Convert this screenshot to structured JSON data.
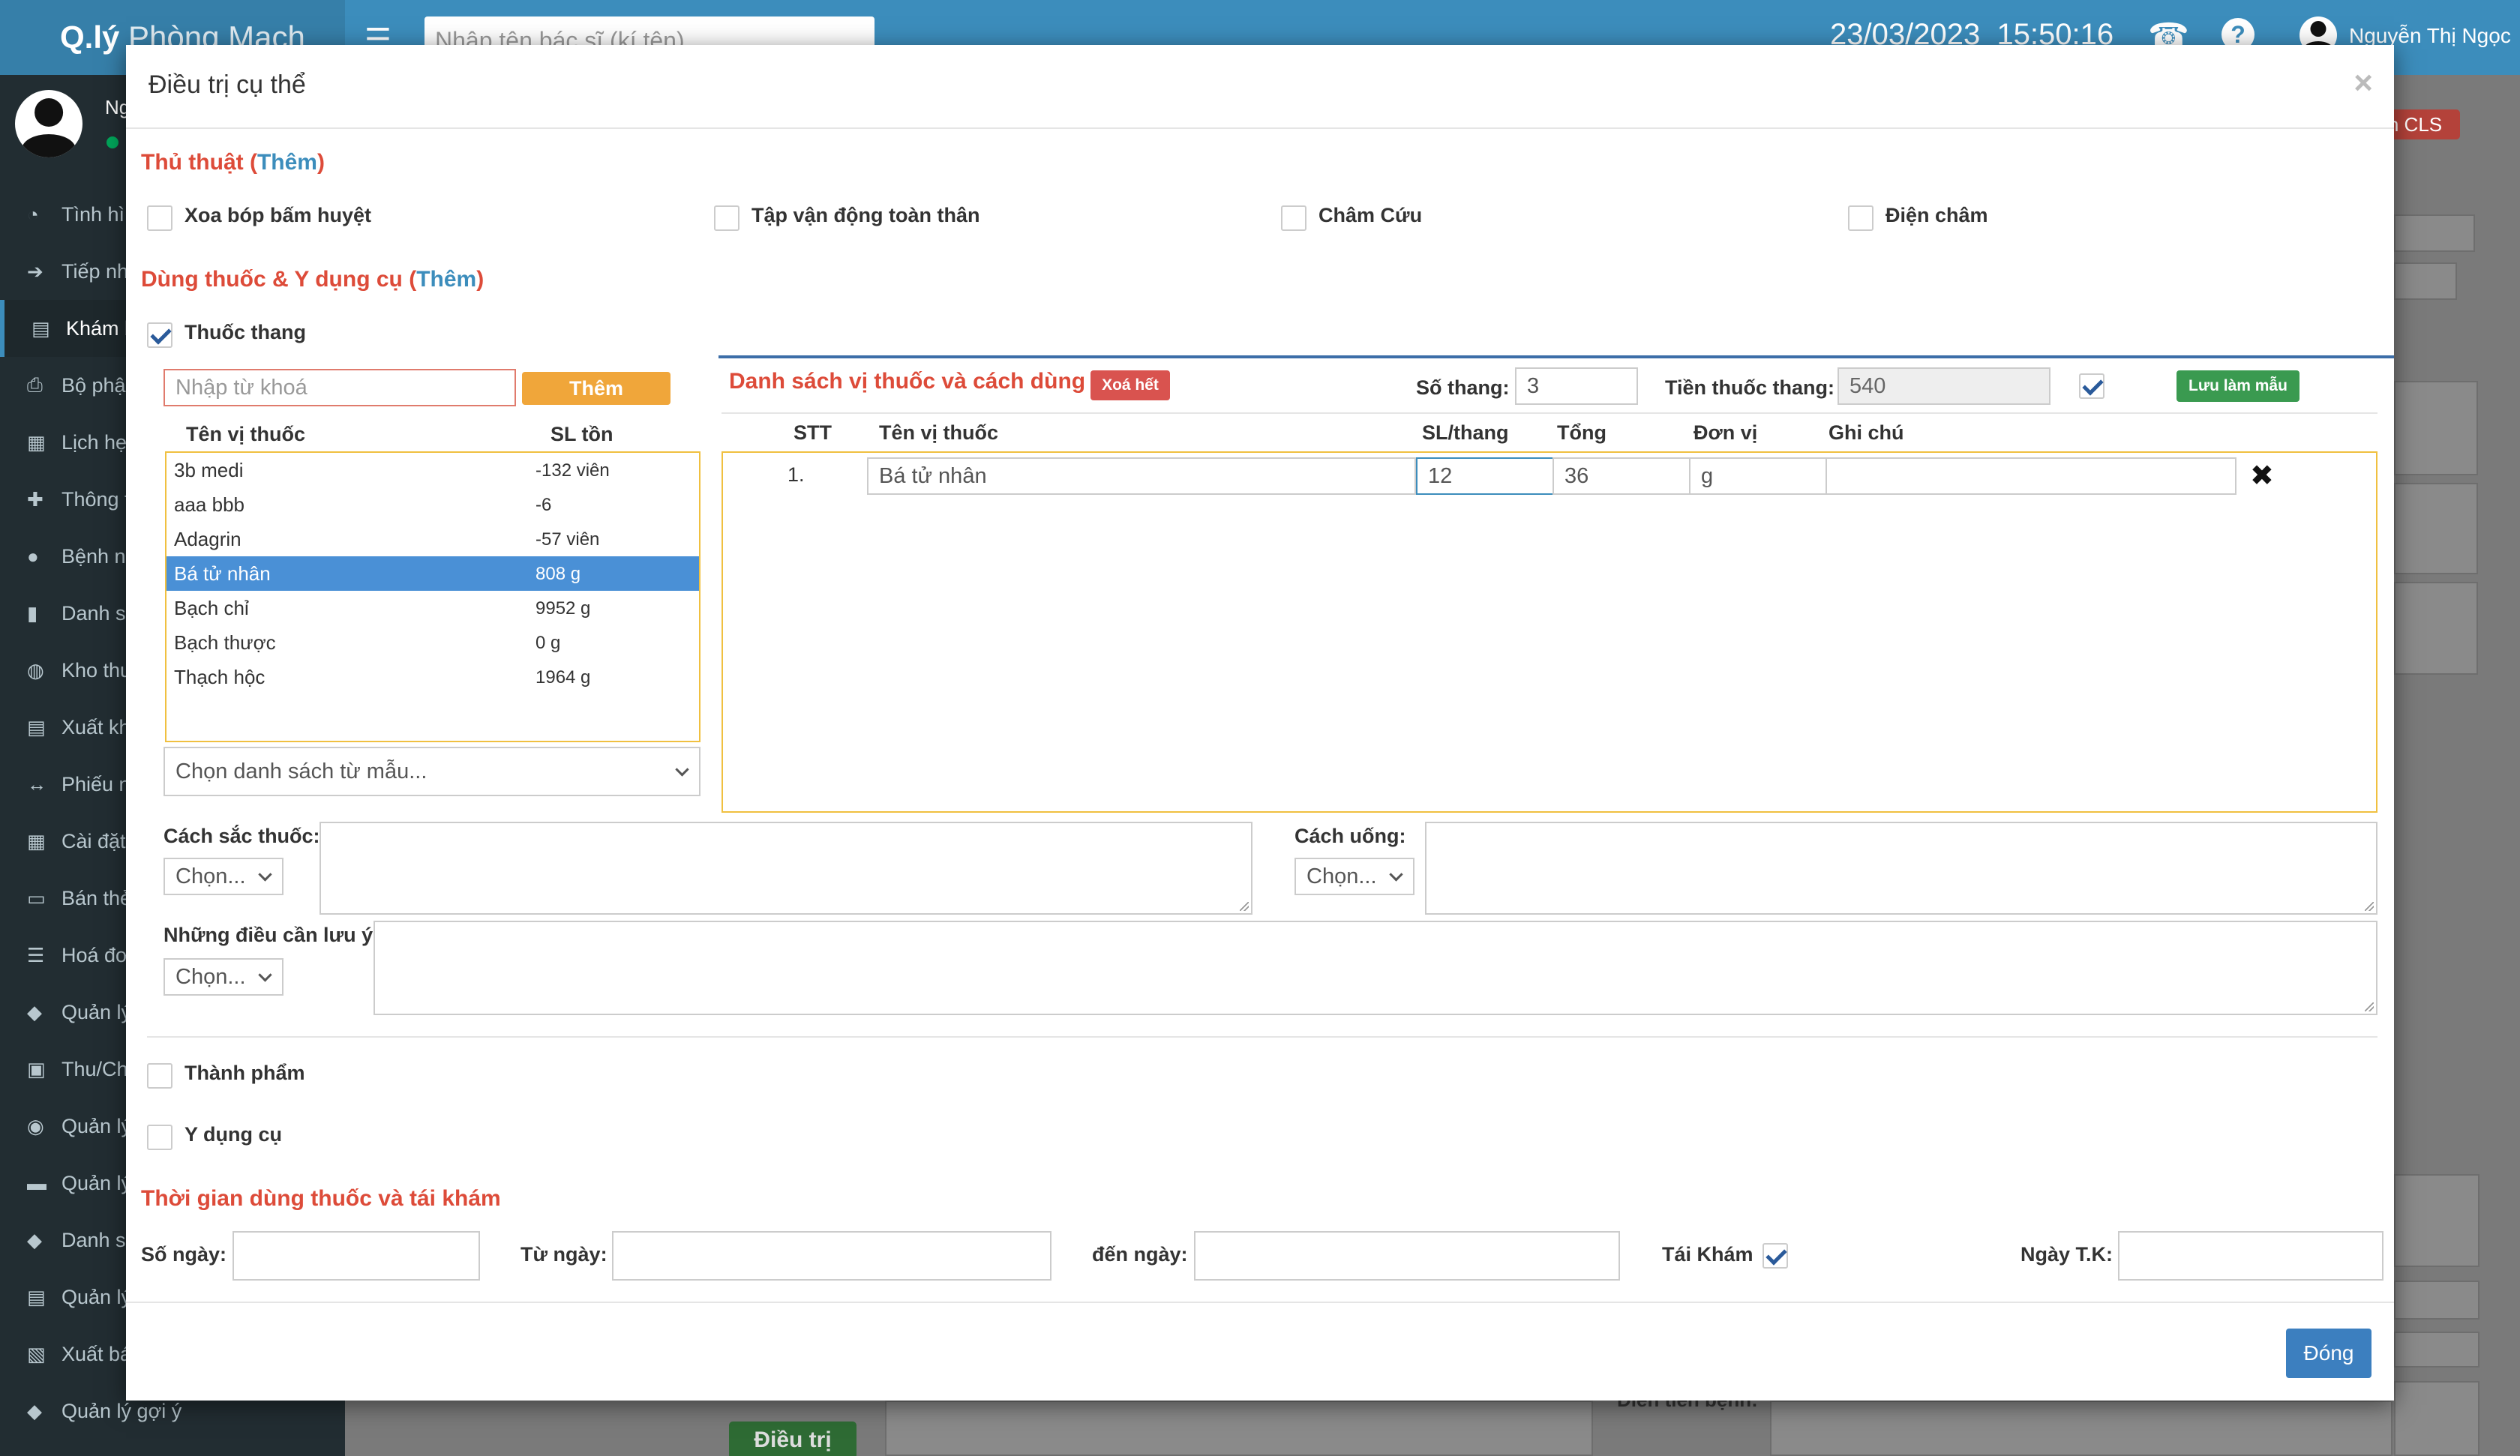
{
  "app": {
    "brand_bold": "Q.lý",
    "brand_light": " Phòng Mạch",
    "doctor_search_placeholder": "Nhập tên bác sĩ (kí tên)",
    "date": "23/03/2023",
    "time": "15:50:16",
    "user_name": "Nguyễn Thị Ngọc",
    "side_user": "Ng",
    "cls_button": "h CLS",
    "dieutri_button": "Điều trị",
    "dien_tien_label": "Diễn tiến bệnh:",
    "sidebar": [
      {
        "label": "Tình hì",
        "icon": "pie-chart-icon"
      },
      {
        "label": "Tiếp nh",
        "icon": "sign-in-icon"
      },
      {
        "label": "Khám b",
        "icon": "clipboard-icon"
      },
      {
        "label": "Bộ phậ",
        "icon": "print-icon"
      },
      {
        "label": "Lịch hẹ",
        "icon": "calendar-icon"
      },
      {
        "label": "Thông t",
        "icon": "plus-icon"
      },
      {
        "label": "Bệnh nh",
        "icon": "user-icon"
      },
      {
        "label": "Danh sá",
        "icon": "file-icon"
      },
      {
        "label": "Kho thu",
        "icon": "dashboard-icon"
      },
      {
        "label": "Xuất kh",
        "icon": "clipboard-icon"
      },
      {
        "label": "Phiếu n",
        "icon": "arrows-icon"
      },
      {
        "label": "Cài đặt",
        "icon": "table-icon"
      },
      {
        "label": "Bán thẻ",
        "icon": "card-icon"
      },
      {
        "label": "Hoá đơ",
        "icon": "list-icon"
      },
      {
        "label": "Quản lý",
        "icon": "tag-icon"
      },
      {
        "label": "Thu/Ch",
        "icon": "money-icon"
      },
      {
        "label": "Quản lý",
        "icon": "users-icon"
      },
      {
        "label": "Quản lý",
        "icon": "briefcase-icon"
      },
      {
        "label": "Danh sá",
        "icon": "tags-icon"
      },
      {
        "label": "Quản lý",
        "icon": "clipboard-icon"
      },
      {
        "label": "Xuất bá",
        "icon": "excel-icon"
      },
      {
        "label": "Quản lý gợi ý",
        "icon": "tags-icon"
      }
    ]
  },
  "modal": {
    "title": "Điều trị cụ thể",
    "close": "×",
    "thu_thuat": {
      "title": "Thủ thuật (",
      "add": "Thêm",
      "close_paren": ")",
      "options": [
        "Xoa bóp bấm huyệt",
        "Tập vận động toàn thân",
        "Châm Cứu",
        "Điện châm"
      ]
    },
    "dung_thuoc": {
      "title": "Dùng thuốc & Y dụng cụ (",
      "add": "Thêm",
      "close_paren": ")"
    },
    "thuoc_thang": {
      "label": "Thuốc thang",
      "search_placeholder": "Nhập từ khoá",
      "search_button": "Thêm",
      "col_name": "Tên vị thuốc",
      "col_stock": "SL tồn",
      "drugs": [
        {
          "name": "3b medi",
          "stock": "-132 viên"
        },
        {
          "name": "aaa bbb",
          "stock": "-6"
        },
        {
          "name": "Adagrin",
          "stock": "-57 viên"
        },
        {
          "name": "Bá tử nhân",
          "stock": "808 g"
        },
        {
          "name": "Bạch chỉ",
          "stock": "9952 g"
        },
        {
          "name": "Bạch thược",
          "stock": "0 g"
        },
        {
          "name": "Thạch hộc",
          "stock": "1964 g"
        }
      ],
      "template_select": "Chọn danh sách từ mẫu...",
      "list_title": "Danh sách vị thuốc và cách dùng",
      "clear_all": "Xoá hết",
      "so_thang_label": "Số thang:",
      "so_thang": "3",
      "tien_label": "Tiền thuốc thang:",
      "tien": "540",
      "save_template": "Lưu làm mẫu",
      "headers": {
        "stt": "STT",
        "name": "Tên vị thuốc",
        "sl": "SL/thang",
        "tong": "Tổng",
        "dv": "Đơn vị",
        "note": "Ghi chú"
      },
      "rows": [
        {
          "stt": "1.",
          "name": "Bá tử nhân",
          "sl": "12",
          "tong": "36",
          "dv": "g",
          "note": ""
        }
      ],
      "cach_sac_label": "Cách sắc thuốc:",
      "cach_uong_label": "Cách uống:",
      "luu_y_label": "Những điều cần lưu ý:",
      "chon": "Chọn..."
    },
    "thanh_pham": "Thành phẩm",
    "y_dung_cu": "Y dụng cụ",
    "thoi_gian": {
      "title": "Thời gian dùng thuốc và tái khám",
      "so_ngay": "Số ngày:",
      "tu_ngay": "Từ ngày:",
      "den_ngay": "đến ngày:",
      "tai_kham": "Tái Khám",
      "ngay_tk": "Ngày T.K:"
    },
    "footer_close": "Đóng"
  }
}
